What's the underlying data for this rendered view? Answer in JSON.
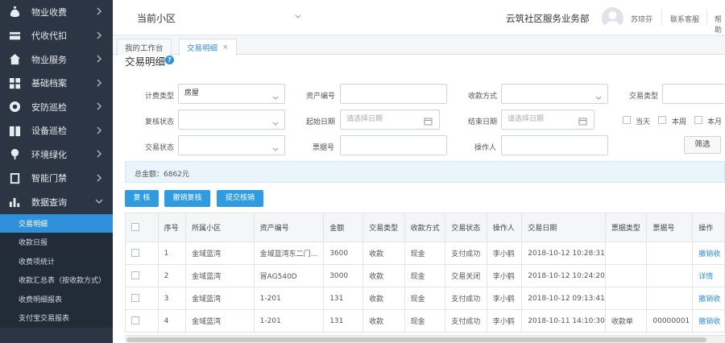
{
  "sidebar": {
    "items": [
      {
        "label": "物业收费",
        "icon": "money-bag-icon"
      },
      {
        "label": "代收代扣",
        "icon": "card-icon"
      },
      {
        "label": "物业服务",
        "icon": "home-icon"
      },
      {
        "label": "基础档案",
        "icon": "grid-icon"
      },
      {
        "label": "安防巡检",
        "icon": "target-icon"
      },
      {
        "label": "设备巡检",
        "icon": "book-icon"
      },
      {
        "label": "环境绿化",
        "icon": "tree-icon"
      },
      {
        "label": "智能门禁",
        "icon": "door-icon"
      },
      {
        "label": "数据查询",
        "icon": "bar-chart-icon"
      }
    ],
    "sub_items": [
      "交易明细",
      "收款日报",
      "收费项统计",
      "收款汇总表（按收款方式）",
      "收费明细报表",
      "支付宝交易报表"
    ],
    "active_sub": "交易明细"
  },
  "topbar": {
    "community_label": "当前小区",
    "department": "云筑社区服务业务部",
    "user_name": "苏琼芬",
    "contact": "联系客服",
    "help": "帮助"
  },
  "tabs": [
    {
      "label": "我的工作台"
    },
    {
      "label": "交易明细",
      "close": "×"
    }
  ],
  "page_title": "交易明细",
  "filters": {
    "billing_type": {
      "label": "计费类型",
      "value": "房屋"
    },
    "asset_no": {
      "label": "资产编号",
      "value": ""
    },
    "payment_method": {
      "label": "收款方式",
      "value": ""
    },
    "trade_type": {
      "label": "交易类型",
      "value": ""
    },
    "review_status": {
      "label": "复核状态",
      "value": ""
    },
    "start_date": {
      "label": "起始日期",
      "placeholder": "请选择日期"
    },
    "end_date": {
      "label": "结束日期",
      "placeholder": "请选择日期"
    },
    "quick_range": [
      "当天",
      "本周",
      "本月"
    ],
    "trade_status": {
      "label": "交易状态",
      "value": ""
    },
    "receipt_no": {
      "label": "票据号",
      "value": ""
    },
    "operator": {
      "label": "操作人",
      "value": ""
    },
    "filter_button": "筛选"
  },
  "summary": "总金额：6862元",
  "actions": [
    "复 核",
    "撤销复核",
    "提交核销"
  ],
  "table": {
    "headers": [
      "序号",
      "所属小区",
      "资产编号",
      "金额",
      "交易类型",
      "收款方式",
      "交易状态",
      "操作人",
      "交易日期",
      "票据类型",
      "票据号",
      "操作"
    ],
    "rows": [
      [
        "1",
        "金域蓝湾",
        "金域蓝湾东二门...",
        "3600",
        "收款",
        "现金",
        "支付成功",
        "李小鹤",
        "2018-10-12 10:28:31",
        "",
        "",
        "撤销收"
      ],
      [
        "2",
        "金域蓝湾",
        "冒AG540D",
        "3000",
        "收款",
        "现金",
        "交易关闭",
        "李小鹤",
        "2018-10-12 10:24:20",
        "",
        "",
        "详情"
      ],
      [
        "3",
        "金域蓝湾",
        "1-201",
        "131",
        "收款",
        "现金",
        "支付成功",
        "李小鹤",
        "2018-10-12 09:13:41",
        "",
        "",
        "撤销收"
      ],
      [
        "4",
        "金域蓝湾",
        "1-201",
        "131",
        "收款",
        "现金",
        "支付成功",
        "李小鹤",
        "2018-10-11 14:10:30",
        "收款单",
        "00000001",
        "撤销收"
      ]
    ]
  },
  "colors": {
    "sidebar_bg": "#2b3544",
    "accent": "#2f8fd8",
    "button": "#2f9be0"
  }
}
